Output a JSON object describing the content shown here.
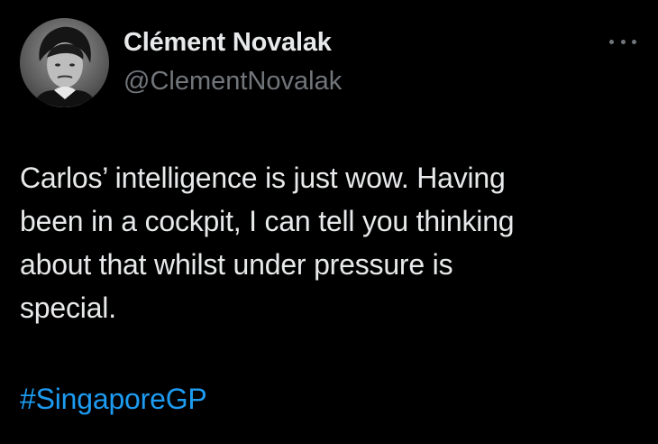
{
  "author": {
    "display_name": "Clément Novalak",
    "handle": "@ClementNovalak",
    "avatar_icon": "profile-photo"
  },
  "menu": {
    "icon": "more-options-icon"
  },
  "tweet": {
    "text": "Carlos’ intelligence is just wow. Having\nbeen in a cockpit, I can tell you thinking\nabout that whilst under pressure is\nspecial.",
    "hashtag": "#SingaporeGP"
  },
  "colors": {
    "background": "#000000",
    "primary_text": "#e7e9ea",
    "secondary_text": "#71767b",
    "link": "#1d9bf0"
  }
}
